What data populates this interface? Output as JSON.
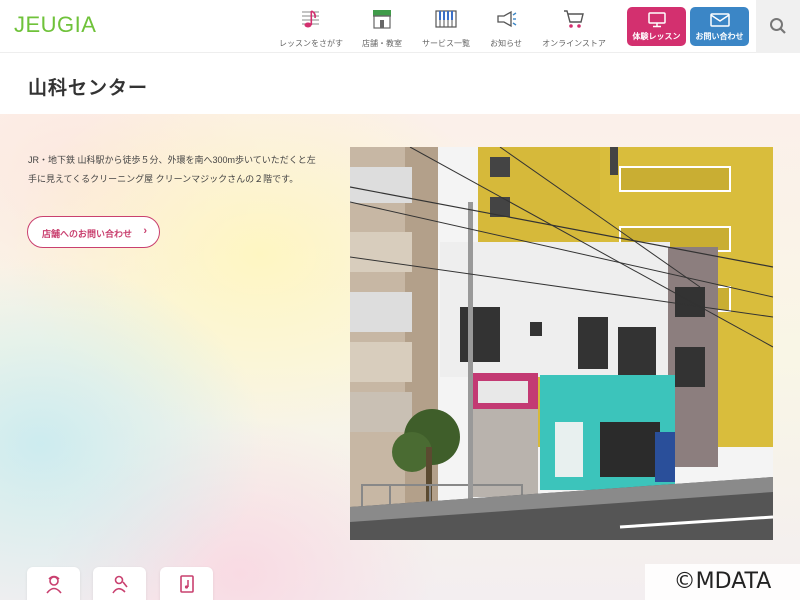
{
  "header": {
    "logo": "JEUGIA",
    "nav": [
      {
        "label": "レッスンをさがす",
        "icon": "music-note-icon"
      },
      {
        "label": "店舗・教室",
        "icon": "store-icon"
      },
      {
        "label": "サービス一覧",
        "icon": "piano-keys-icon"
      },
      {
        "label": "お知らせ",
        "icon": "megaphone-icon"
      },
      {
        "label": "オンラインストア",
        "icon": "cart-icon"
      }
    ],
    "trial_label": "体験レッスン",
    "contact_label": "お問い合わせ",
    "search_icon": "search-icon"
  },
  "page": {
    "title": "山科センター",
    "description": "JR・地下鉄 山科駅から徒歩５分、外環を南へ300m歩いていただくと左手に見えてくるクリーニング屋 クリーンマジックさんの２階です。",
    "contact_link": "店舗へのお問い合わせ",
    "contact_arrow": "›"
  },
  "colors": {
    "brand_green": "#6fc23a",
    "trial_pink": "#d3306f",
    "contact_blue": "#3b86c6",
    "link_pink": "#c9406f"
  },
  "tiles": [
    {
      "icon": "person-icon"
    },
    {
      "icon": "singer-icon"
    },
    {
      "icon": "music-book-icon"
    }
  ],
  "watermark": "©MDATA"
}
